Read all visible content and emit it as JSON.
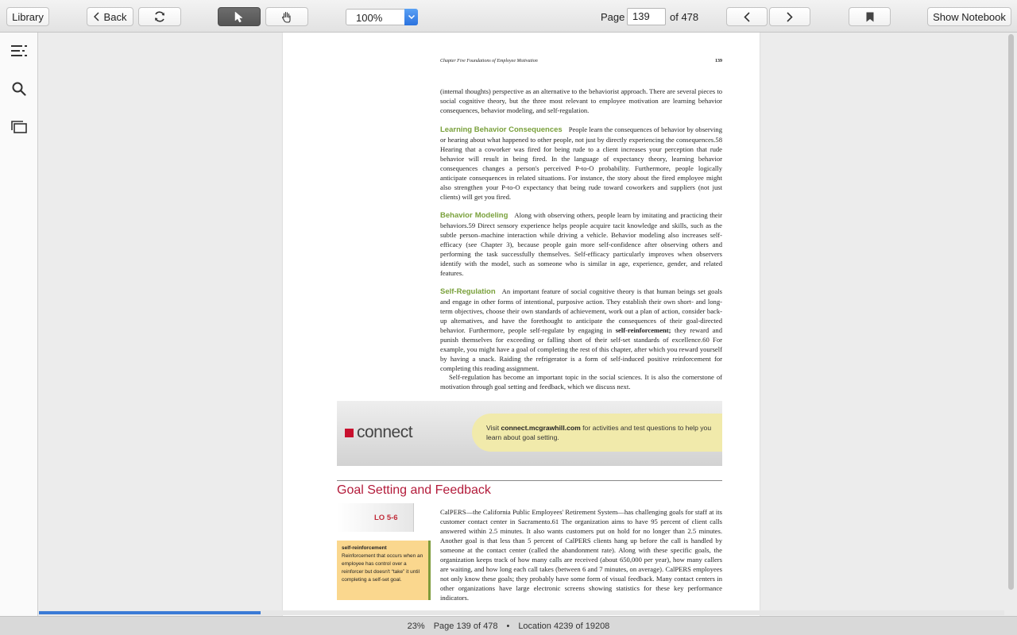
{
  "toolbar": {
    "library_label": "Library",
    "back_label": "Back",
    "zoom_value": "100%",
    "page_label": "Page",
    "page_value": "139",
    "page_total": "of 478",
    "notebook_label": "Show Notebook"
  },
  "page": {
    "running_head": "Chapter Five   Foundations of Employee Motivation",
    "page_number": "139",
    "intro": "(internal thoughts) perspective as an alternative to the behaviorist approach. There are several pieces to social cognitive theory, but the three most relevant to employee motivation are learning behavior consequences, behavior modeling, and self-regulation.",
    "learning_heading": "Learning Behavior Consequences",
    "learning_text": "People learn the consequences of behavior by observing or hearing about what happened to other people, not just by directly experiencing the consequences.58 Hearing that a coworker was fired for being rude to a client increases your perception that rude behavior will result in being fired. In the language of expectancy theory, learning behavior consequences changes a person's perceived P-to-O probability. Furthermore, people logically anticipate consequences in related situations. For instance, the story about the fired employee might also strengthen your P-to-O expectancy that being rude toward coworkers and suppliers (not just clients) will get you fired.",
    "modeling_heading": "Behavior Modeling",
    "modeling_text": "Along with observing others, people learn by imitating and practicing their behaviors.59 Direct sensory experience helps people acquire tacit knowledge and skills, such as the subtle person–machine interaction while driving a vehicle. Behavior modeling also increases self-efficacy (see Chapter 3), because people gain more self-confidence after observing others and performing the task successfully themselves. Self-efficacy particularly improves when observers identify with the model, such as someone who is similar in age, experience, gender, and related features.",
    "selfreg_heading": "Self-Regulation",
    "selfreg_text_1": "An important feature of social cognitive theory is that human beings set goals and engage in other forms of intentional, purposive action. They establish their own short- and long-term objectives, choose their own standards of achievement, work out a plan of action, consider back-up alternatives, and have the forethought to anticipate the consequences of their goal-directed behavior. Furthermore, people self-regulate by engaging in",
    "selfreg_bold": "self-reinforcement;",
    "selfreg_text_2": "they reward and punish themselves for exceeding or falling short of their self-set standards of excellence.60 For example, you might have a goal of completing the rest of this chapter, after which you reward yourself by having a snack. Raiding the refrigerator is a form of self-induced positive reinforcement for completing this reading assignment.",
    "selfreg_text_3": "Self-regulation has become an important topic in the social sciences. It is also the cornerstone of motivation through goal setting and feedback, which we discuss next.",
    "connect_logo": "connect",
    "connect_visit_1": "Visit",
    "connect_url": "connect.mcgrawhill.com",
    "connect_visit_2": "for activities and test questions to help you learn about goal setting.",
    "section_title": "Goal Setting and Feedback",
    "lo_label": "LO 5-6",
    "def_term": "self-reinforcement",
    "def_text": "Reinforcement that occurs when an employee has control over a reinforcer but doesn't “take” it until completing a self-set goal.",
    "calpers_text": "CalPERS—the California Public Employees' Retirement System—has challenging goals for staff at its customer contact center in Sacramento.61 The organization aims to have 95 percent of client calls answered within 2.5 minutes. It also wants customers put on hold for no longer than 2.5 minutes. Another goal is that less than 5 percent of CalPERS clients hang up before the call is handled by someone at the contact center (called the abandonment rate). Along with these specific goals, the organization keeps track of how many calls are received (about 650,000 per year), how many callers are waiting, and how long each call takes (between 6 and 7 minutes, on average). CalPERS employees not only know these goals; they probably have some form of visual feedback. Many contact centers in other organizations have large electronic screens showing statistics for these key performance indicators."
  },
  "progress": {
    "fraction": 0.23
  },
  "status": {
    "percent": "23%",
    "page": "Page 139 of 478",
    "separator": "•",
    "location": "Location 4239 of 19208"
  }
}
